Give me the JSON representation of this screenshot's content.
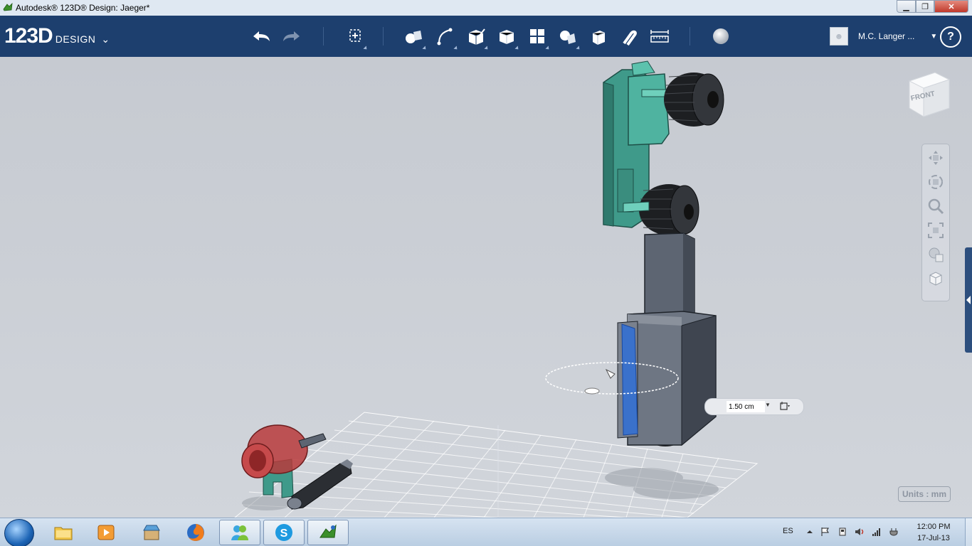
{
  "window": {
    "title": "Autodesk® 123D® Design: Jaeger*"
  },
  "brand": {
    "number": "123D",
    "word": "DESIGN"
  },
  "toolbar": {
    "tools": [
      {
        "name": "undo-icon"
      },
      {
        "name": "redo-icon"
      },
      {
        "name": "transform-icon"
      },
      {
        "name": "primitives-icon"
      },
      {
        "name": "sketch-icon"
      },
      {
        "name": "construct-icon"
      },
      {
        "name": "modify-icon"
      },
      {
        "name": "pattern-icon"
      },
      {
        "name": "grouping-icon"
      },
      {
        "name": "combine-icon"
      },
      {
        "name": "snap-icon"
      },
      {
        "name": "measure-icon"
      },
      {
        "name": "material-icon"
      }
    ]
  },
  "user": {
    "name": "M.C. Langer ..."
  },
  "help": {
    "label": "?"
  },
  "viewcube": {
    "face": "FRONT"
  },
  "dimension": {
    "value": "1.50 cm"
  },
  "units": {
    "label": "Units : mm"
  },
  "taskbar": {
    "language": "ES",
    "time": "12:00 PM",
    "date": "17-Jul-13"
  },
  "colors": {
    "toolbar": "#1d3f6e",
    "model_teal": "#3f9a8a",
    "model_grey": "#5d6572",
    "selection_blue": "#2f6fd6",
    "red_part": "#b8393b"
  }
}
